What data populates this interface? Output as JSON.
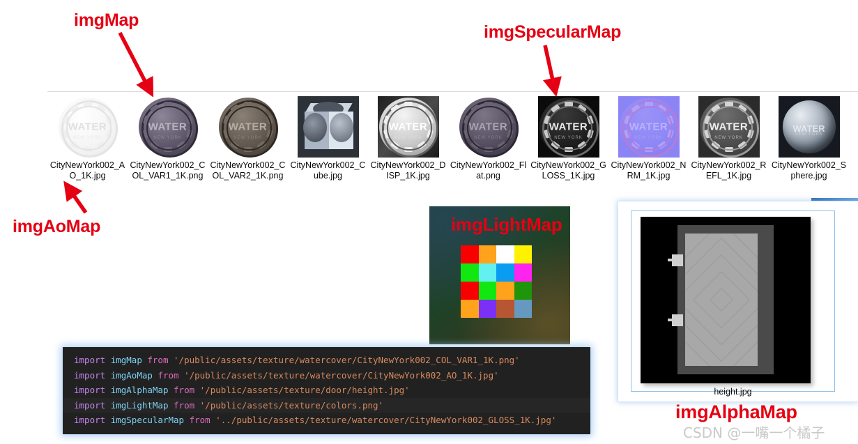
{
  "annotations": [
    {
      "key": "imgmap",
      "label": "imgMap"
    },
    {
      "key": "imgspecularmap",
      "label": "imgSpecularMap"
    },
    {
      "key": "imgaomap",
      "label": "imgAoMap"
    },
    {
      "key": "imglightmap",
      "label": "imgLightMap"
    },
    {
      "key": "imgalphamap",
      "label": "imgAlphaMap"
    }
  ],
  "thumbnails": [
    {
      "label": "CityNewYork002_AO_1K.jpg",
      "kind": "cover-ao"
    },
    {
      "label": "CityNewYork002_COL_VAR1_1K.png",
      "kind": "cover-col1"
    },
    {
      "label": "CityNewYork002_COL_VAR2_1K.png",
      "kind": "cover-col2"
    },
    {
      "label": "CityNewYork002_Cube.jpg",
      "kind": "cube"
    },
    {
      "label": "CityNewYork002_DISP_1K.jpg",
      "kind": "cover-disp"
    },
    {
      "label": "CityNewYork002_Flat.png",
      "kind": "cover-flat"
    },
    {
      "label": "CityNewYork002_GLOSS_1K.jpg",
      "kind": "cover-gloss"
    },
    {
      "label": "CityNewYork002_NRM_1K.jpg",
      "kind": "cover-nrm"
    },
    {
      "label": "CityNewYork002_REFL_1K.jpg",
      "kind": "cover-refl"
    },
    {
      "label": "CityNewYork002_Sphere.jpg",
      "kind": "sphere"
    }
  ],
  "cover_text": {
    "word": "WATER",
    "sub": "NEW YORK"
  },
  "lightmap": {
    "title": "imgLightMap",
    "grid_colors": [
      "#f80000",
      "#ffa21c",
      "#ffffff",
      "#fff200",
      "#12e712",
      "#63f0f0",
      "#0a9cf0",
      "#ff23ef",
      "#f80000",
      "#12e712",
      "#ffa21c",
      "#1f9509",
      "#ffa21c",
      "#7b31f5",
      "#b75632",
      "#6699c0"
    ]
  },
  "alphamap": {
    "file_label": "height.jpg"
  },
  "code": {
    "lines": [
      {
        "kw": "import",
        "var": "imgMap",
        "from": "from",
        "str": "'/public/assets/texture/watercover/CityNewYork002_COL_VAR1_1K.png'",
        "highlight": false
      },
      {
        "kw": "import",
        "var": "imgAoMap",
        "from": "from",
        "str": "'/public/assets/texture/watercover/CityNewYork002_AO_1K.jpg'",
        "highlight": false
      },
      {
        "kw": "import",
        "var": "imgAlphaMap",
        "from": "from",
        "str": "'/public/assets/texture/door/height.jpg'",
        "highlight": false
      },
      {
        "kw": "import",
        "var": "imgLightMap",
        "from": "from",
        "str": "'/public/assets/texture/colors.png'",
        "highlight": true
      },
      {
        "kw": "import",
        "var": "imgSpecularMap",
        "from": "from",
        "str": "'../public/assets/texture/watercover/CityNewYork002_GLOSS_1K.jpg'",
        "highlight": false
      }
    ]
  },
  "watermark": {
    "text": "CSDN @一嘴一个橘子"
  },
  "colors": {
    "annotation_red": "#e60013",
    "code_bg": "#212121",
    "keyword": "#c586f0",
    "variable": "#7fd2f5",
    "from": "#e06ec0",
    "string": "#d98a5e",
    "glow": "#96c3f5"
  }
}
